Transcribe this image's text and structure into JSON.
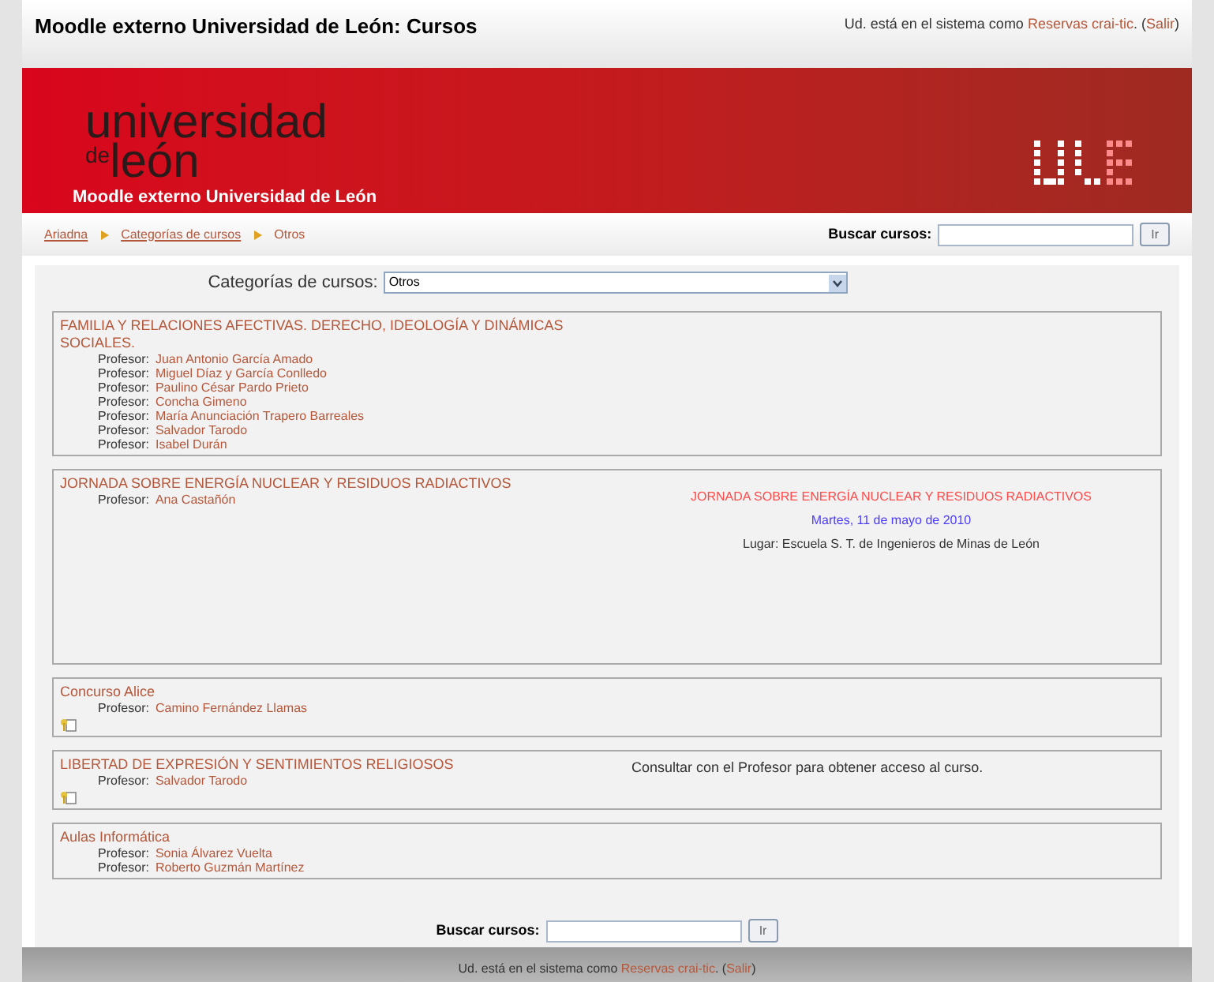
{
  "header": {
    "title": "Moodle externo Universidad de León: Cursos",
    "login": {
      "prefix": "Ud. está en el sistema como",
      "user": "Reservas crai-tic",
      "middle": ". (",
      "logout": "Salir",
      "end": ")"
    }
  },
  "banner": {
    "logo_lines": [
      "universidad",
      "de",
      "león"
    ],
    "subtitle": "Moodle externo Universidad de León"
  },
  "breadcrumb": [
    {
      "label": "Ariadna",
      "link": true
    },
    {
      "label": "Categorías de cursos",
      "link": true
    },
    {
      "label": "Otros",
      "link": false
    }
  ],
  "search_top": {
    "label": "Buscar cursos:",
    "button": "Ir"
  },
  "category_select": {
    "label": "Categorías de cursos:",
    "value": "Otros"
  },
  "courses": [
    {
      "name": "FAMILIA Y RELACIONES AFECTIVAS. DERECHO, IDEOLOGÍA Y DINÁMICAS SOCIALES.",
      "teachers": [
        {
          "label": "Profesor:",
          "name": "Juan Antonio García Amado"
        },
        {
          "label": "Profesor:",
          "name": "Miguel Díaz y García Conlledo"
        },
        {
          "label": "Profesor:",
          "name": "Paulino César Pardo Prieto"
        },
        {
          "label": "Profesor:",
          "name": "Concha Gimeno"
        },
        {
          "label": "Profesor:",
          "name": "María Anunciación Trapero Barreales"
        },
        {
          "label": "Profesor:",
          "name": "Salvador Tarodo"
        },
        {
          "label": "Profesor:",
          "name": "Isabel Durán"
        }
      ]
    },
    {
      "name": "JORNADA SOBRE ENERGÍA NUCLEAR Y RESIDUOS RADIACTIVOS",
      "teachers": [
        {
          "label": "Profesor:",
          "name": "Ana Castañón"
        }
      ],
      "summary": [
        {
          "kind": "title",
          "text": "JORNADA SOBRE ENERGÍA NUCLEAR Y RESIDUOS RADIACTIVOS"
        },
        {
          "kind": "date",
          "text": "Martes, 11 de mayo de 2010"
        },
        {
          "kind": "place",
          "text": "Lugar: Escuela S. T. de Ingenieros de Minas de León"
        }
      ]
    },
    {
      "name": "Concurso Alice",
      "teachers": [
        {
          "label": "Profesor:",
          "name": "Camino Fernández Llamas"
        }
      ],
      "guest_icon": true
    },
    {
      "name": "LIBERTAD DE EXPRESIÓN Y SENTIMIENTOS RELIGIOSOS",
      "teachers": [
        {
          "label": "Profesor:",
          "name": "Salvador Tarodo"
        }
      ],
      "guest_icon": true,
      "summary": [
        {
          "kind": "note",
          "text": "Consultar con el Profesor para obtener acceso al curso."
        }
      ]
    },
    {
      "name": "Aulas Informática",
      "teachers": [
        {
          "label": "Profesor:",
          "name": "Sonia Álvarez Vuelta"
        },
        {
          "label": "Profesor:",
          "name": "Roberto Guzmán Martínez"
        }
      ]
    }
  ],
  "search_bottom": {
    "label": "Buscar cursos:",
    "button": "Ir"
  },
  "footer": {
    "prefix": "Ud. está en el sistema como",
    "user": "Reservas crai-tic",
    "middle": ". (",
    "logout": "Salir",
    "end": ")"
  }
}
